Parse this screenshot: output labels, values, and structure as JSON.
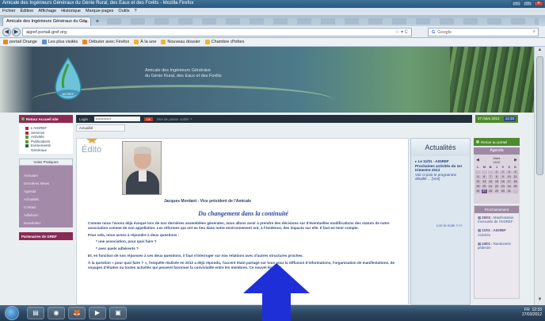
{
  "window": {
    "title": "Amicale des Ingénieurs Généraux du Génie Rural, des Eaux et des Forêts - Mozilla Firefox",
    "controls": [
      "–",
      "□",
      "✕"
    ]
  },
  "menubar": [
    "Fichier",
    "Édition",
    "Affichage",
    "Historique",
    "Marque-pages",
    "Outils",
    "?"
  ],
  "tabs": [
    {
      "label": "Amicale des Ingénieurs Généraux du Gé...",
      "close": "✕"
    }
  ],
  "newtab": "+",
  "nav": {
    "back": "◀",
    "forward": "▶",
    "url": "aigref.portail-gref.org",
    "url_icons": "☆ ▾ C",
    "search_placeholder": "Google",
    "search_engine": "G",
    "search_icon": "⌕"
  },
  "bookmarks": [
    {
      "label": "portail Orange",
      "color": "#e88a21"
    },
    {
      "label": "Les plus visités",
      "color": "#5a8fd4"
    },
    {
      "label": "Débuter avec Firefox",
      "color": "#e88a21"
    },
    {
      "label": "À la une",
      "color": "#f2b530"
    },
    {
      "label": "Nouveau dossier",
      "color": "#f2b530"
    },
    {
      "label": "Chambre d'hôtes",
      "color": "#f2b530"
    }
  ],
  "banner": {
    "org_line1": "Amicale des Ingénieurs Généraux",
    "org_line2": "du Génie Rural, des Eaux et des Forêts",
    "logo_text": "AIGREF"
  },
  "sidebar": {
    "head": "Retour Accueil site",
    "menu": [
      "L'AIGREF",
      "Services",
      "Activités",
      "Publications",
      "Evènements"
    ],
    "menu_extra": "Généraux",
    "vp_title": "Voies Pratiques",
    "vp_items": [
      "Annuaire",
      "Dernières News",
      "Agenda",
      "Actualités",
      "Contact",
      "Adhésion",
      "Newsletter"
    ],
    "partners": "Partenaires de GREF"
  },
  "login": {
    "label": "Login :",
    "password_mask": "••••••••••••••",
    "ok": "OK",
    "forgot": "Mot de passe oublié ?"
  },
  "datebar": {
    "date": "27 mars 2012",
    "time": "12:33"
  },
  "breadcrumb": "Actualité",
  "main": {
    "edito": "Édito",
    "caption": "Jacques Mordant - Vice président de l'Amicale",
    "headline": "Du changement dans la continuité",
    "paragraphs": [
      "Comme nous l'avons déjà évoqué lors de nos dernières assemblées générales, nous allons avoir à prendre des décisions sur d'éventuelles modifications des statuts de notre association comme de son appellation. Les réformes qui ont eu lieu dans notre environnement ont, à l'évidence, des impacts sur elle. Il faut en tenir compte.",
      "Pour cela, nous avons à répondre à deux questions :",
      "* une association, pour quoi faire ?",
      "* avec quels adhérents ?",
      "Et, en fonction de nos réponses à ces deux questions, il faut s'interroger sur nos relations avec d'autres structures proches.",
      "À la question « pour quoi faire ? », l'enquête réalisée en 2012 a déjà répondu, l'accent étant partagé sur tous pour la diffusion d'informations, l'organisation de manifestations, de voyages d'études ou toutes activités qui peuvent favoriser la convivialité entre les membres. Ce nouvel élan est"
    ]
  },
  "actu": {
    "title": "Actualités",
    "item_date": "Le 11/01 - AIGREF",
    "item_title": "Prochaines activités du 1er trimestre 2013",
    "item_body": "Voir ci-joint le programme détaillé ...",
    "item_more": "[Voir]",
    "more": "Lire la suite >>>"
  },
  "rcol": {
    "head": "Retour au portail",
    "agenda": "Agenda",
    "cal_month": "Mars",
    "cal_year": "2012",
    "cal_prev": "◀",
    "cal_next": "▶",
    "cal_days": [
      "L",
      "M",
      "M",
      "J",
      "V",
      "S",
      "D"
    ],
    "cal_cells": [
      "",
      "",
      "",
      "1",
      "2",
      "3",
      "4",
      "5",
      "6",
      "7",
      "8",
      "9",
      "10",
      "11",
      "12",
      "13",
      "14",
      "15",
      "16",
      "17",
      "18",
      "19",
      "20",
      "21",
      "22",
      "23",
      "24",
      "25",
      "26",
      "27",
      "28",
      "29",
      "30",
      "31",
      ""
    ],
    "cal_highlight": "27",
    "prochain": "Prochainement",
    "events": [
      {
        "date": "26/03 :",
        "text": "Manifestation mensuelle de l'AIGREF"
      },
      {
        "date": "21/01 : AIGREF",
        "text": "Activités"
      },
      {
        "date": "24/01 :",
        "text": "Randonnée pédestre"
      }
    ]
  },
  "taskbar": {
    "apps": [
      "▤",
      "◉",
      "🦊",
      "▶",
      "▣"
    ],
    "tray_lang": "FR",
    "tray_time": "12:33",
    "tray_date": "27/03/2012"
  },
  "colors": {
    "sidebar_head": "#8b2b54",
    "green_head": "#4e8a2e",
    "body_text": "#2f4a85",
    "arrow": "#1f2fd8"
  }
}
